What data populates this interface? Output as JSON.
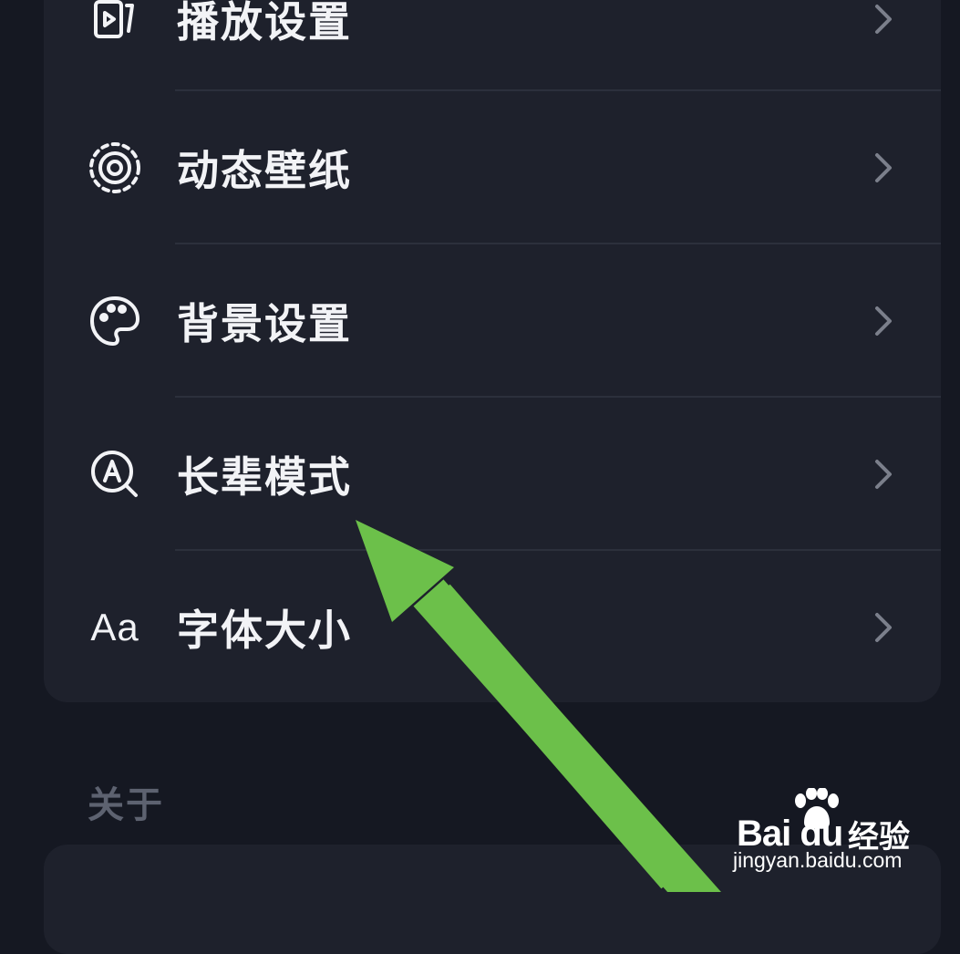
{
  "menu": {
    "items": [
      {
        "label": "播放设置",
        "icon": "play-settings-icon"
      },
      {
        "label": "动态壁纸",
        "icon": "dynamic-wallpaper-icon"
      },
      {
        "label": "背景设置",
        "icon": "palette-icon"
      },
      {
        "label": "长辈模式",
        "icon": "elder-mode-icon"
      },
      {
        "label": "字体大小",
        "icon": "font-size-icon",
        "icon_text": "Aa"
      }
    ]
  },
  "sections": {
    "about_title": "关于"
  },
  "watermark": {
    "brand": "Bai du",
    "jingyan": "经验",
    "url": "jingyan.baidu.com"
  },
  "colors": {
    "background": "#151822",
    "card": "#1e212c",
    "text": "#f2f3f6",
    "muted": "#5d6270",
    "chevron": "#7b7f8b",
    "arrow": "#6cc04a"
  }
}
